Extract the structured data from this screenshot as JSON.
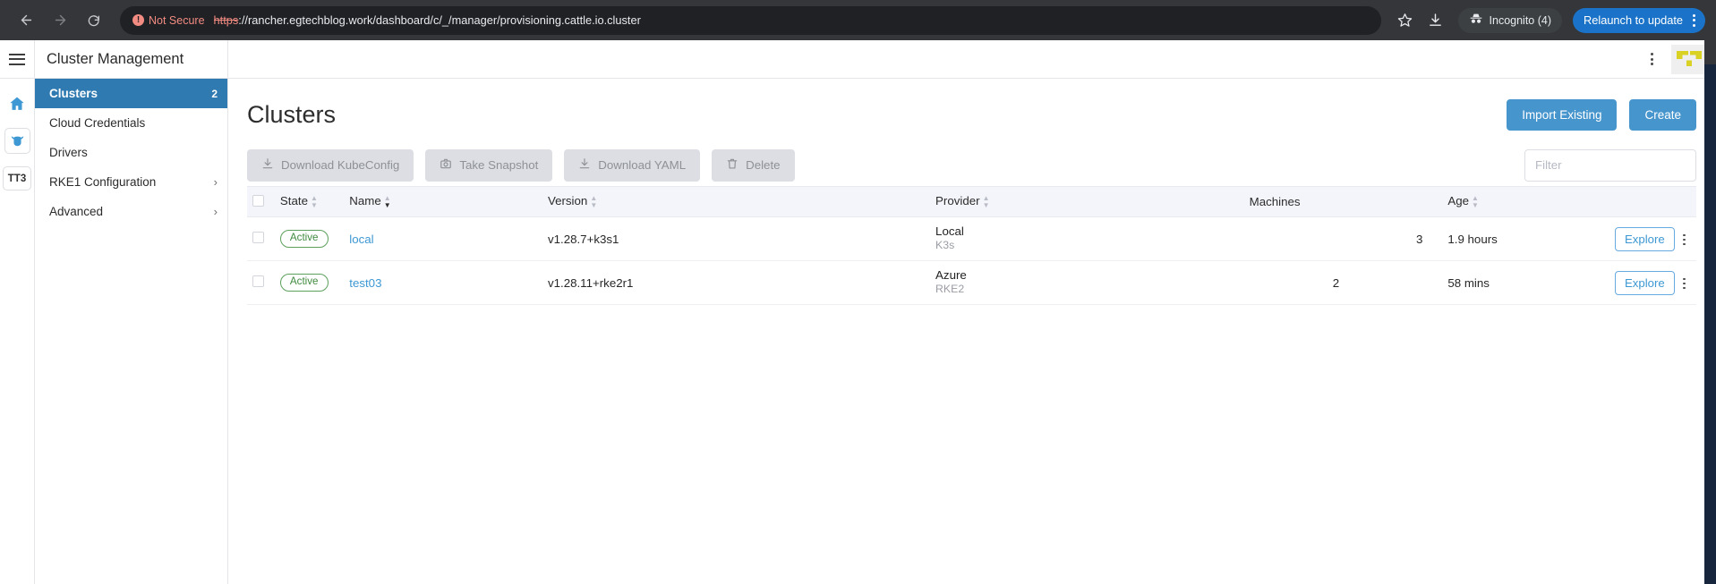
{
  "browser": {
    "back_icon": "arrow-left-icon",
    "forward_icon": "arrow-right-icon",
    "reload_icon": "reload-icon",
    "security_label": "Not Secure",
    "url_scheme": "https",
    "url_rest": "://rancher.egtechblog.work/dashboard/c/_/manager/provisioning.cattle.io.cluster",
    "bookmark_icon": "star-icon",
    "download_icon": "download-icon",
    "incognito_label": "Incognito (4)",
    "relaunch_label": "Relaunch to update",
    "menu_icon": "kebab-menu-icon"
  },
  "header": {
    "hamburger_icon": "hamburger-menu-icon",
    "title": "Cluster Management",
    "menu_icon": "kebab-menu-icon",
    "logo_icon": "rancher-logo-icon"
  },
  "rail": {
    "items": [
      {
        "name": "home-icon",
        "label": ""
      },
      {
        "name": "cluster-icon",
        "label": ""
      },
      {
        "name": "cluster-shortcut",
        "label": "TT3"
      }
    ]
  },
  "sidebar": {
    "items": [
      {
        "label": "Clusters",
        "count": "2",
        "active": true,
        "expandable": false
      },
      {
        "label": "Cloud Credentials",
        "count": "",
        "active": false,
        "expandable": false
      },
      {
        "label": "Drivers",
        "count": "",
        "active": false,
        "expandable": false
      },
      {
        "label": "RKE1 Configuration",
        "count": "",
        "active": false,
        "expandable": true
      },
      {
        "label": "Advanced",
        "count": "",
        "active": false,
        "expandable": true
      }
    ]
  },
  "page": {
    "title": "Clusters",
    "import_label": "Import Existing",
    "create_label": "Create"
  },
  "toolbar": {
    "buttons": [
      {
        "label": "Download KubeConfig",
        "icon": "download-icon"
      },
      {
        "label": "Take Snapshot",
        "icon": "camera-icon"
      },
      {
        "label": "Download YAML",
        "icon": "download-icon"
      },
      {
        "label": "Delete",
        "icon": "trash-icon"
      }
    ],
    "filter_placeholder": "Filter",
    "filter_value": ""
  },
  "table": {
    "columns": [
      {
        "label": "State",
        "sortable": true
      },
      {
        "label": "Name",
        "sortable": true,
        "sorted": true
      },
      {
        "label": "Version",
        "sortable": true
      },
      {
        "label": "Provider",
        "sortable": true
      },
      {
        "label": "Machines",
        "sortable": false
      },
      {
        "label": "Age",
        "sortable": true
      }
    ],
    "rows": [
      {
        "state": "Active",
        "name": "local",
        "version": "v1.28.7+k3s1",
        "provider": "Local",
        "provider_sub": "K3s",
        "machines": "3",
        "machines_bar": false,
        "age": "1.9 hours",
        "explore_label": "Explore"
      },
      {
        "state": "Active",
        "name": "test03",
        "version": "v1.28.11+rke2r1",
        "provider": "Azure",
        "provider_sub": "RKE2",
        "machines": "2",
        "machines_bar": true,
        "age": "58 mins",
        "explore_label": "Explore"
      }
    ]
  },
  "colors": {
    "accent_blue": "#3d98d3",
    "primary_button": "#4795cd",
    "nav_active": "#2f7ab0",
    "active_green": "#3f8a3f",
    "machines_bar": "#a8c5a3",
    "logo_yellow": "#d9d123"
  }
}
